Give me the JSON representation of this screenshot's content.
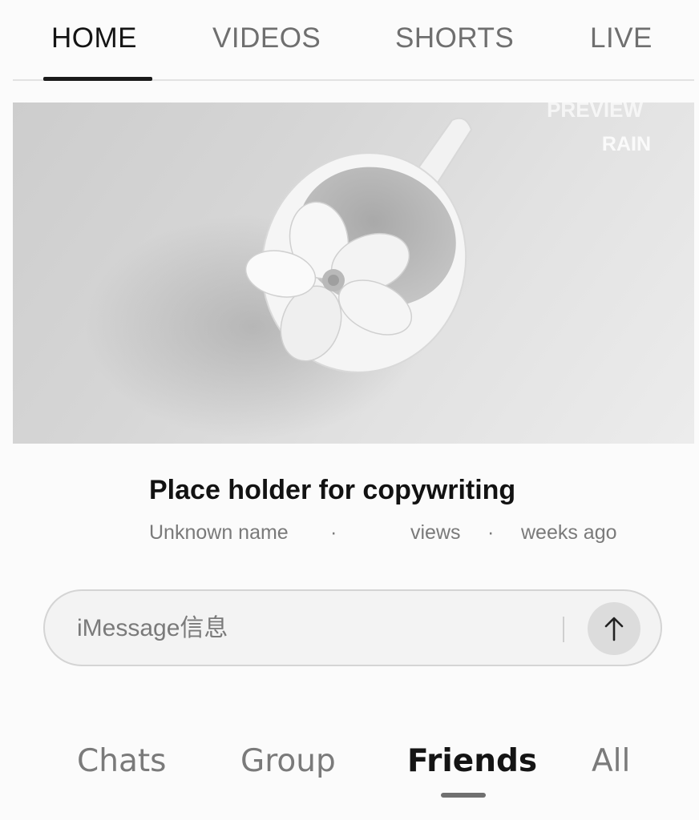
{
  "top_tabs": {
    "items": [
      {
        "label": "HOME",
        "active": true
      },
      {
        "label": "VIDEOS",
        "active": false
      },
      {
        "label": "SHORTS",
        "active": false
      },
      {
        "label": "LIVE",
        "active": false
      }
    ]
  },
  "video": {
    "thumbnail_icon": "flower-in-cup-image",
    "watermark_line1": "PREVIEW",
    "watermark_line2": "RAIN",
    "title": "Place holder for copywriting",
    "channel": "Unknown name",
    "separator": "·",
    "views_label": "views",
    "age_label": "weeks ago"
  },
  "composer": {
    "placeholder": "iMessage信息",
    "send_icon": "arrow-up-icon"
  },
  "bottom_tabs": {
    "items": [
      {
        "label": "Chats",
        "active": false
      },
      {
        "label": "Group",
        "active": false
      },
      {
        "label": "Friends",
        "active": true
      },
      {
        "label": "All",
        "active": false
      }
    ]
  },
  "colors": {
    "background": "#fbfbfb",
    "active_text": "#141414",
    "inactive_text": "#6f6f6f",
    "indicator": "#1a1a1a"
  }
}
